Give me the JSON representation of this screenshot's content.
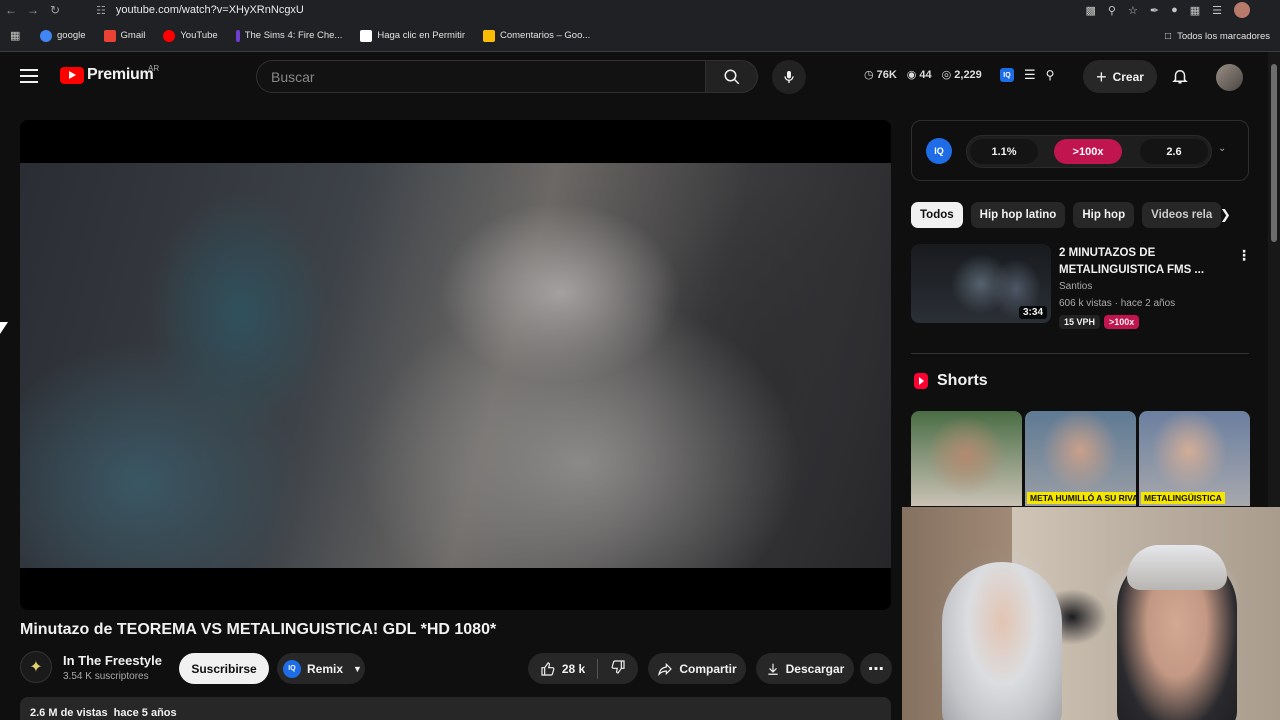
{
  "browser": {
    "url": "youtube.com/watch?v=XHyXRnNcgxU",
    "bookmarks": [
      {
        "label": "google",
        "color": "#4285f4"
      },
      {
        "label": "Gmail",
        "color": "#ea4335"
      },
      {
        "label": "YouTube",
        "color": "#ff0000"
      },
      {
        "label": "The Sims 4: Fire Che...",
        "color": "#6c3fd1"
      },
      {
        "label": "Haga clic en Permitir",
        "color": "#ffffff"
      },
      {
        "label": "Comentarios – Goo...",
        "color": "#fbbc04"
      }
    ],
    "all_bookmarks": "Todos los marcadores"
  },
  "header": {
    "logo_text": "Premium",
    "country": "AR",
    "search_placeholder": "Buscar",
    "stats": {
      "likes": "76K",
      "views": "44",
      "eye": "2,229"
    },
    "create_label": "Crear"
  },
  "video": {
    "title": "Minutazo de TEOREMA VS METALINGUISTICA! GDL *HD 1080*",
    "channel": "In The Freestyle",
    "subscribers": "3.54 K suscriptores",
    "subscribe_label": "Suscribirse",
    "remix_label": "Remix",
    "likes": "28 k",
    "share_label": "Compartir",
    "download_label": "Descargar",
    "views": "2.6 M de vistas",
    "age": "hace 5 años"
  },
  "iq_panel": {
    "metrics": [
      "1.1%",
      ">100x",
      "2.6"
    ]
  },
  "chips": [
    "Todos",
    "Hip hop latino",
    "Hip hop",
    "Videos rela"
  ],
  "recommendation": {
    "title": "2 MINUTAZOS DE METALINGUISTICA FMS ...",
    "channel": "Santios",
    "meta": "606 k vistas · hace 2 años",
    "duration": "3:34",
    "badge_vph": "15 VPH",
    "badge_ratio": ">100x"
  },
  "shorts": {
    "heading": "Shorts",
    "captions": [
      "",
      "META HUMILLÓ A SU RIVAL",
      "METALINGÜISTICA"
    ]
  },
  "colors": {
    "accent": "#ff0000",
    "iq_blue": "#1e6de6",
    "hot_pink": "#c1154f"
  }
}
